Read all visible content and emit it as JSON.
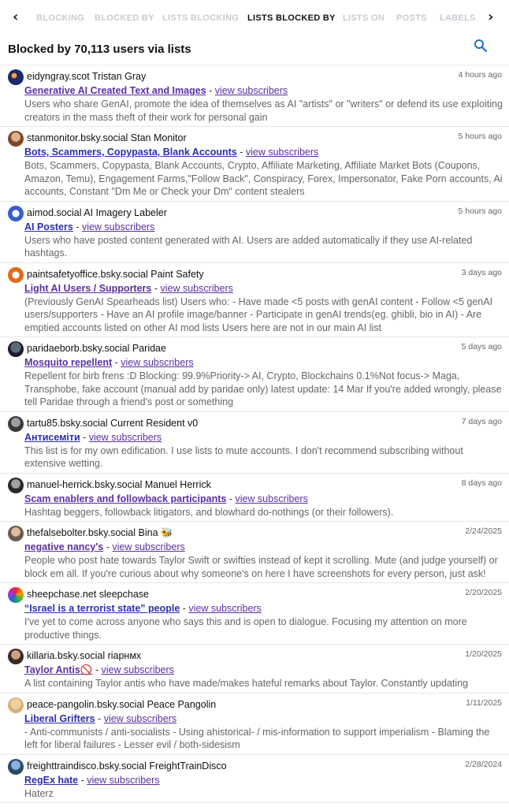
{
  "tabs": [
    "BLOCKING",
    "BLOCKED BY",
    "LISTS BLOCKING",
    "LISTS BLOCKED BY",
    "LISTS ON",
    "POSTS",
    "LABELS"
  ],
  "nav": {
    "left": "‹",
    "right": "›"
  },
  "header": {
    "title": "Blocked by 70,113 users via lists"
  },
  "subscribers_label": "view subscribers",
  "items": [
    {
      "user": "eidyngray.scot Tristan Gray",
      "time": "4 hours ago",
      "list": "Generative AI Created Text and Images",
      "desc": "Users who share GenAI, promote the idea of themselves as AI \"artists\" or \"writers\" or defend its use exploiting creators in the mass theft of their work for personal gain"
    },
    {
      "user": "stanmonitor.bsky.social Stan Monitor",
      "time": "5 hours ago",
      "list": "Bots, Scammers, Copypasta, Blank Accounts",
      "desc": "Bots, Scammers, Copypasta, Blank Accounts, Crypto, Affiliate Marketing, Affiliate Market Bots (Coupons, Amazon, Temu), Engagement Farms,\"Follow Back\", Conspiracy, Forex, Impersonator, Fake Porn accounts, Ai accounts, Constant \"Dm Me or Check your Dm\" content stealers"
    },
    {
      "user": "aimod.social AI Imagery Labeler",
      "time": "5 hours ago",
      "list": "AI Posters",
      "desc": "Users who have posted content generated with AI. Users are added automatically if they use AI-related hashtags."
    },
    {
      "user": "paintsafetyoffice.bsky.social Paint Safety",
      "time": "3 days ago",
      "list": "Light AI Users / Supporters",
      "desc": "(Previously GenAI Spearheads list) Users who: - Have made <5 posts with genAI content - Follow <5 genAI users/supporters - Have an AI profile image/banner - Participate in genAI trends(eg. ghibli, bio in AI) - Are emptied accounts listed on other AI mod lists Users here are not in our main AI list"
    },
    {
      "user": "paridaeborb.bsky.social Paridae",
      "time": "5 days ago",
      "list": "Mosquito repellent",
      "desc": "Repellent for birb frens :D Blocking: 99.9%Priority-> AI, Crypto, Blockchains 0.1%Not focus-> Maga, Transphobe, fake account (manual add by paridae only) latest update: 14 Mar If you're added wrongly, please tell Paridae through a friend's post or something"
    },
    {
      "user": "tartu85.bsky.social Current Resident v0",
      "time": "7 days ago",
      "list": "Антисеміти",
      "desc": "This list is for my own edification. I use lists to mute accounts. I don't recommend subscribing without extensive wetting."
    },
    {
      "user": "manuel-herrick.bsky.social Manuel Herrick",
      "time": "8 days ago",
      "list": "Scam enablers and followback participants",
      "desc": "Hashtag beggers, followback litigators, and blowhard do-nothings (or their followers)."
    },
    {
      "user": "thefalsebolter.bsky.social Bina 🐝",
      "time": "2/24/2025",
      "list": "negative nancy's",
      "desc": "People who post hate towards Taylor Swift or swifties instead of kept it scrolling. Mute (and judge yourself) or block em all. If you're curious about why someone's on here I have screenshots for every person, just ask!"
    },
    {
      "user": "sheepchase.net sleepchase",
      "time": "2/20/2025",
      "list": "“Israel is a terrorist state” people",
      "desc": "I've yet to come across anyone who says this and is open to dialogue. Focusing my attention on more productive things."
    },
    {
      "user": "killaria.bsky.social riарнмх",
      "time": "1/20/2025",
      "list": "Taylor Antis🚫",
      "desc": "A list containing Taylor antis who have made/makes hateful remarks about Taylor. Constantly updating"
    },
    {
      "user": "peace-pangolin.bsky.social Peace Pangolin",
      "time": "1/11/2025",
      "list": "Liberal Grifters",
      "desc": "- Anti-communists / anti-socialists - Using ahistorical- / mis-information to support imperialism - Blaming the left for liberal failures - Lesser evil / both-sidesism"
    },
    {
      "user": "freighttraindisco.bsky.social FreightTrainDisco",
      "time": "2/28/2024",
      "list": "RegEx hate",
      "desc": "Haterz"
    }
  ],
  "colors": {
    "accent": "#1a73c8",
    "link": "#2d2db0",
    "visited": "#5b2fa0",
    "muted": "#666666"
  }
}
